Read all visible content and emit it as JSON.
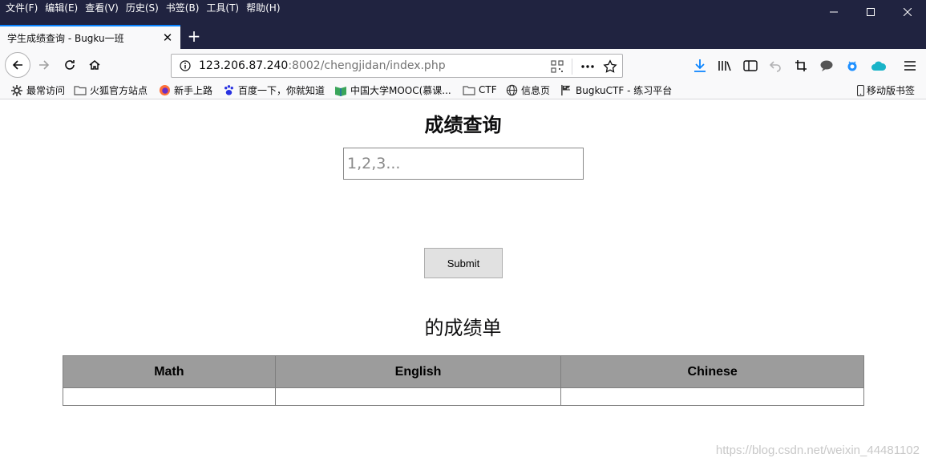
{
  "menu": [
    "文件(F)",
    "编辑(E)",
    "查看(V)",
    "历史(S)",
    "书签(B)",
    "工具(T)",
    "帮助(H)"
  ],
  "tab": {
    "title": "学生成绩查询 - Bugku一班"
  },
  "urlbar": {
    "host": "123.206.87.240",
    "rest": ":8002/chengjidan/index.php"
  },
  "bookmarks": {
    "items": [
      "最常访问",
      "火狐官方站点",
      "新手上路",
      "百度一下，你就知道",
      "中国大学MOOC(慕课...",
      "CTF",
      "信息页",
      "BugkuCTF - 练习平台"
    ],
    "mobile": "移动版书签"
  },
  "page": {
    "title": "成绩查询",
    "input_placeholder": "1,2,3...",
    "submit_label": "Submit",
    "report_title": "的成绩单",
    "table_headers": [
      "Math",
      "English",
      "Chinese"
    ]
  },
  "watermark": "https://blog.csdn.net/weixin_44481102",
  "colors": {
    "accent": "#0a84ff",
    "titlebar": "#202340",
    "table_header": "#9c9c9c"
  }
}
